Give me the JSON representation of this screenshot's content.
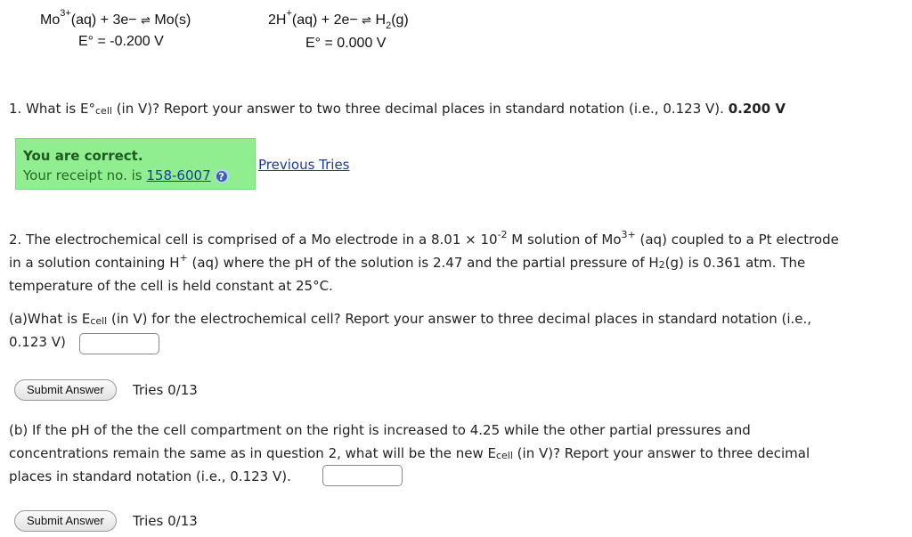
{
  "reactions": {
    "mo": {
      "species": "Mo",
      "charge": "3+",
      "left_rest": "(aq) + 3e− ",
      "arrow": "⇌",
      "right": " Mo(s)",
      "potential": "E° = -0.200 V"
    },
    "h": {
      "species": "2H",
      "charge": "+",
      "left_rest": "(aq) + 2e− ",
      "arrow": "⇌",
      "right_pre": " H",
      "right_sub": "2",
      "right_post": "(g)",
      "potential": "E° = 0.000 V"
    }
  },
  "q1": {
    "prefix": "1. What is E°",
    "sub": "cell",
    "rest": " (in V)? Report your answer to two three decimal places in standard notation (i.e., 0.123 V). ",
    "answer": "0.200 V"
  },
  "feedback": {
    "heading": "You are correct.",
    "receipt_prefix": "Your receipt no. is ",
    "receipt_no": "158-6007",
    "help_icon": "?",
    "previous_tries": "Previous Tries"
  },
  "q2": {
    "p1": "2. The electrochemical cell is comprised of a Mo electrode in a 8.01 × 10",
    "exp": "-2",
    "p2": " M solution of Mo",
    "charge": "3+",
    "p3": " (aq) coupled to a Pt electrode",
    "line2_a": "in a solution containing H",
    "line2_sup": "+",
    "line2_b": " (aq) where the pH of the solution is 2.47 and the partial pressure of H",
    "line2_sub": "2",
    "line2_c": "(g) is 0.361 atm. The",
    "line3": "temperature of the cell is held constant at 25°C."
  },
  "qa": {
    "prefix": "(a)What is E",
    "sub": "cell",
    "rest": " (in V) for the electrochemical cell? Report your answer to three decimal places in standard notation (i.e.,",
    "line2": "0.123 V)",
    "input_value": "",
    "submit": "Submit Answer",
    "tries": "Tries 0/13"
  },
  "qb": {
    "line1": "(b) If the pH of the the cell compartment on the right is increased to 4.25 while the other partial pressures and",
    "line2_a": "concentrations remain the same as in question 2, what will be the new E",
    "line2_sub": "cell",
    "line2_b": " (in V)? Report your answer to three decimal",
    "line3": "places in standard notation (i.e., 0.123 V).",
    "input_value": "",
    "submit": "Submit Answer",
    "tries": "Tries 0/13"
  }
}
